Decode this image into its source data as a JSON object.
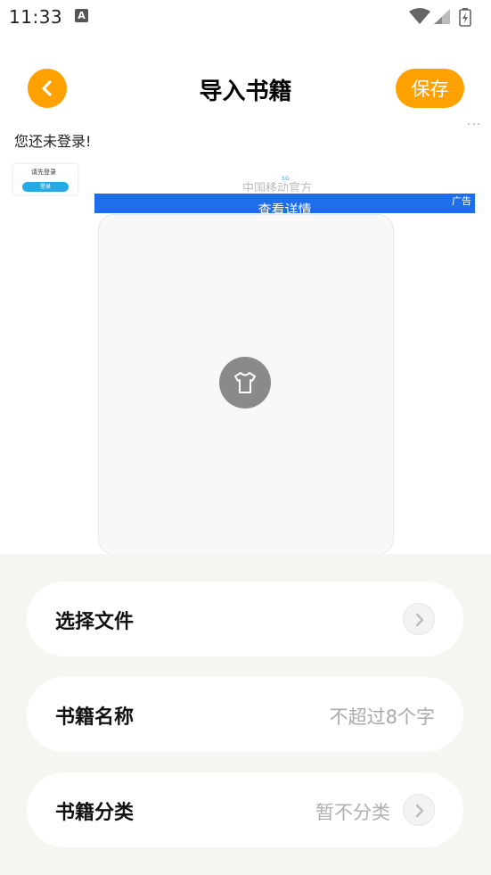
{
  "status_bar": {
    "time": "11:33",
    "notification_icon": "a-icon",
    "right_icons": [
      "wifi-icon",
      "signal-icon",
      "battery-charging-icon"
    ]
  },
  "header": {
    "back_icon": "chevron-left-icon",
    "title": "导入书籍",
    "save_label": "保存"
  },
  "colors": {
    "accent": "#FFA100",
    "ad_blue": "#1E6DEB",
    "form_background": "#F6F5F1",
    "placeholder_text": "#AAAAAA"
  },
  "login_notice": "您还未登录!",
  "ad": {
    "thumb_text": "请先登录",
    "thumb_button": "登录",
    "faded_text": "中国移动官方",
    "badge": "5G",
    "banner_text": "查看详情",
    "label": "广告"
  },
  "cover": {
    "icon": "tshirt-icon"
  },
  "form": {
    "select_file": {
      "label": "选择文件"
    },
    "book_name": {
      "label": "书籍名称",
      "placeholder": "不超过8个字"
    },
    "book_category": {
      "label": "书籍分类",
      "value": "暂不分类"
    }
  }
}
